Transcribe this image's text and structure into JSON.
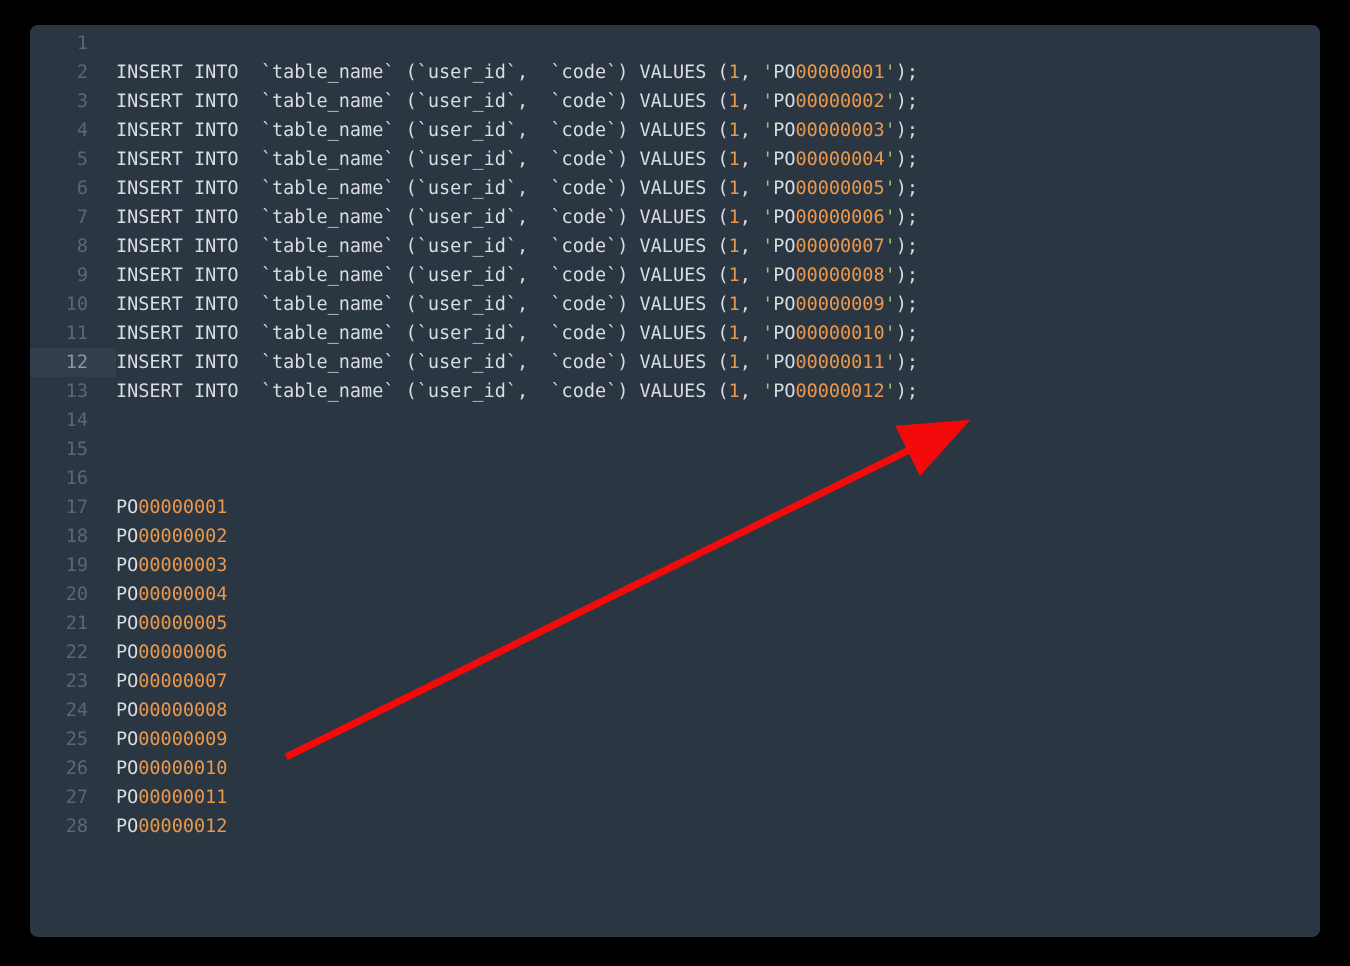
{
  "editor": {
    "highlightedLine": 12,
    "lines": [
      {
        "n": 1,
        "type": "empty"
      },
      {
        "n": 2,
        "type": "insert",
        "po": "00000001"
      },
      {
        "n": 3,
        "type": "insert",
        "po": "00000002"
      },
      {
        "n": 4,
        "type": "insert",
        "po": "00000003"
      },
      {
        "n": 5,
        "type": "insert",
        "po": "00000004"
      },
      {
        "n": 6,
        "type": "insert",
        "po": "00000005"
      },
      {
        "n": 7,
        "type": "insert",
        "po": "00000006"
      },
      {
        "n": 8,
        "type": "insert",
        "po": "00000007"
      },
      {
        "n": 9,
        "type": "insert",
        "po": "00000008"
      },
      {
        "n": 10,
        "type": "insert",
        "po": "00000009"
      },
      {
        "n": 11,
        "type": "insert",
        "po": "00000010"
      },
      {
        "n": 12,
        "type": "insert",
        "po": "00000011"
      },
      {
        "n": 13,
        "type": "insert",
        "po": "00000012"
      },
      {
        "n": 14,
        "type": "empty"
      },
      {
        "n": 15,
        "type": "empty"
      },
      {
        "n": 16,
        "type": "empty"
      },
      {
        "n": 17,
        "type": "po",
        "po": "00000001"
      },
      {
        "n": 18,
        "type": "po",
        "po": "00000002"
      },
      {
        "n": 19,
        "type": "po",
        "po": "00000003"
      },
      {
        "n": 20,
        "type": "po",
        "po": "00000004"
      },
      {
        "n": 21,
        "type": "po",
        "po": "00000005"
      },
      {
        "n": 22,
        "type": "po",
        "po": "00000006"
      },
      {
        "n": 23,
        "type": "po",
        "po": "00000007"
      },
      {
        "n": 24,
        "type": "po",
        "po": "00000008"
      },
      {
        "n": 25,
        "type": "po",
        "po": "00000009"
      },
      {
        "n": 26,
        "type": "po",
        "po": "00000010"
      },
      {
        "n": 27,
        "type": "po",
        "po": "00000011"
      },
      {
        "n": 28,
        "type": "po",
        "po": "00000012"
      }
    ],
    "sql": {
      "insert": "INSERT INTO",
      "table": "`table_name`",
      "col1": "`user_id`",
      "col2": "`code`",
      "values": "VALUES",
      "userId": "1",
      "poPrefix": "PO"
    }
  }
}
